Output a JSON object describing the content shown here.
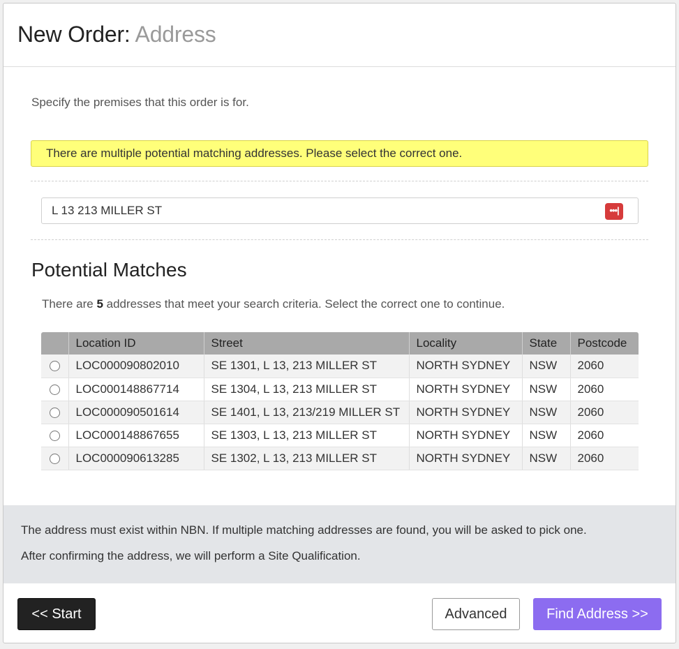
{
  "header": {
    "title": "New Order:",
    "subtitle": "Address"
  },
  "intro": "Specify the premises that this order is for.",
  "alert": "There are multiple potential matching addresses. Please select the correct one.",
  "search": {
    "value": "L 13 213 MILLER ST",
    "icon": "password-manager-icon",
    "icon_color": "#d63b3b"
  },
  "matches": {
    "title": "Potential Matches",
    "criteria_prefix": "There are",
    "count": "5",
    "criteria_suffix": "addresses that meet your search criteria. Select the correct one to continue.",
    "columns": [
      "Location ID",
      "Street",
      "Locality",
      "State",
      "Postcode"
    ],
    "rows": [
      {
        "location_id": "LOC000090802010",
        "street": "SE 1301, L 13, 213 MILLER ST",
        "locality": "NORTH SYDNEY",
        "state": "NSW",
        "postcode": "2060"
      },
      {
        "location_id": "LOC000148867714",
        "street": "SE 1304, L 13, 213 MILLER ST",
        "locality": "NORTH SYDNEY",
        "state": "NSW",
        "postcode": "2060"
      },
      {
        "location_id": "LOC000090501614",
        "street": "SE 1401, L 13, 213/219 MILLER ST",
        "locality": "NORTH SYDNEY",
        "state": "NSW",
        "postcode": "2060"
      },
      {
        "location_id": "LOC000148867655",
        "street": "SE 1303, L 13, 213 MILLER ST",
        "locality": "NORTH SYDNEY",
        "state": "NSW",
        "postcode": "2060"
      },
      {
        "location_id": "LOC000090613285",
        "street": "SE 1302, L 13, 213 MILLER ST",
        "locality": "NORTH SYDNEY",
        "state": "NSW",
        "postcode": "2060"
      }
    ]
  },
  "info": {
    "line1": "The address must exist within NBN. If multiple matching addresses are found, you will be asked to pick one.",
    "line2": "After confirming the address, we will perform a Site Qualification."
  },
  "buttons": {
    "start": "<< Start",
    "advanced": "Advanced",
    "find": "Find Address >>"
  },
  "colors": {
    "alert_bg": "#ffff7a",
    "primary": "#8c6cf0",
    "dark": "#222222",
    "table_header": "#a9a9a9"
  }
}
